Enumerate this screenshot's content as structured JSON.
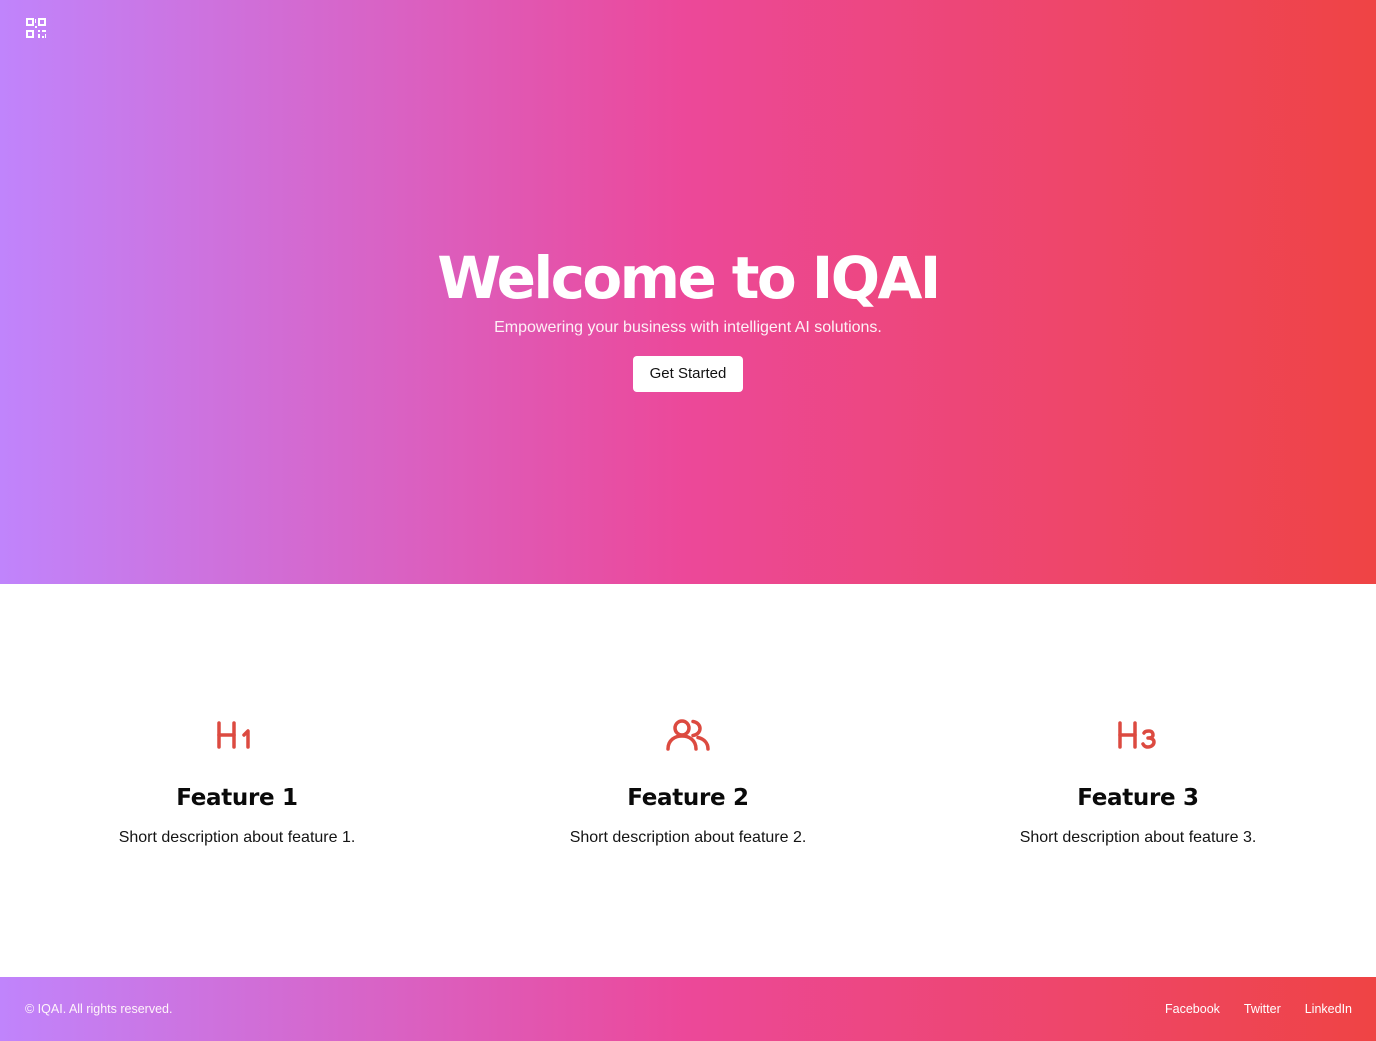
{
  "header": {
    "logo_icon": "qr-code-icon"
  },
  "hero": {
    "title": "Welcome to IQAI",
    "subtitle": "Empowering your business with intelligent AI solutions.",
    "cta_label": "Get Started",
    "gradient": [
      "#c084fc",
      "#ec4899",
      "#ef4444"
    ]
  },
  "features": {
    "accent_color": "#dc4a40",
    "items": [
      {
        "icon": "heading-1-icon",
        "title": "Feature 1",
        "description": "Short description about feature 1."
      },
      {
        "icon": "users-icon",
        "title": "Feature 2",
        "description": "Short description about feature 2."
      },
      {
        "icon": "heading-3-icon",
        "title": "Feature 3",
        "description": "Short description about feature 3."
      }
    ]
  },
  "footer": {
    "copyright": "© IQAI. All rights reserved.",
    "links": [
      "Facebook",
      "Twitter",
      "LinkedIn"
    ]
  }
}
